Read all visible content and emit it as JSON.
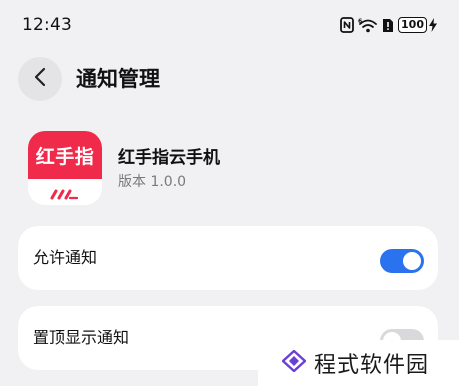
{
  "status_bar": {
    "time": "12:43",
    "battery_level": "100",
    "icons": [
      "nfc-icon",
      "wifi-6-icon",
      "sim-alert-icon",
      "battery-icon",
      "charging-bolt-icon"
    ]
  },
  "header": {
    "title": "通知管理",
    "back_icon": "chevron-left-icon"
  },
  "app": {
    "icon_text": "红手指",
    "name": "红手指云手机",
    "version": "版本 1.0.0",
    "brand_color": "#ef2a4a"
  },
  "settings": [
    {
      "label": "允许通知",
      "enabled": true
    },
    {
      "label": "置顶显示通知",
      "enabled": false
    }
  ],
  "watermark": {
    "text": "程式软件园"
  },
  "colors": {
    "background": "#f1f1f3",
    "card": "#ffffff",
    "toggle_on": "#2b73ee",
    "toggle_off": "#d9d9dc"
  }
}
